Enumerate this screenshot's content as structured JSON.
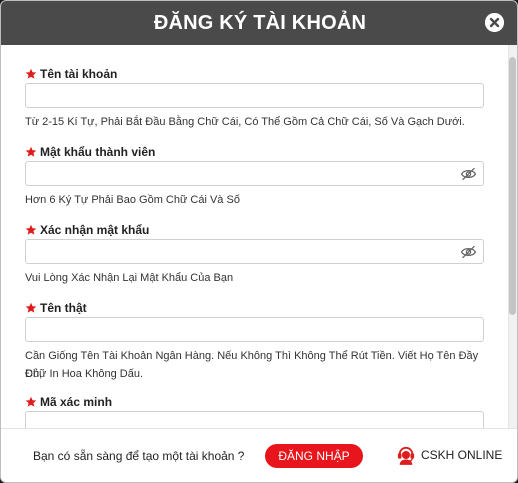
{
  "header": {
    "title": "ĐĂNG KÝ TÀI KHOẢN"
  },
  "fields": [
    {
      "label": "Tên tài khoản",
      "value": "",
      "hint": "Từ 2-15 Kí Tự, Phải Bắt Đầu Bằng Chữ Cái, Có Thể Gồm Cả Chữ Cái, Số Và Gạch Dưới."
    },
    {
      "label": "Mật khẩu thành viên",
      "value": "",
      "hint": "Hơn 6 Ký Tự Phải Bao Gồm Chữ Cái Và Số"
    },
    {
      "label": "Xác nhận mật khẩu",
      "value": "",
      "hint": "Vui Lòng Xác Nhận Lại Mật Khẩu Của Bạn"
    },
    {
      "label": "Tên thật",
      "value": "",
      "hint_line1": "Cần Giống Tên Tài Khoản Ngân Hàng. Nếu Không Thì Không Thể Rút Tiền. Viết Họ Tên Đầy Đủ,",
      "hint_line2": "Chữ In Hoa Không Dấu."
    },
    {
      "label": "Mã xác minh",
      "value": ""
    }
  ],
  "footer": {
    "prompt": "Bạn có sẵn sàng để tạo một tài khoản ?",
    "login_label": "ĐĂNG NHẬP",
    "support_label": "CSKH ONLINE"
  },
  "colors": {
    "header": "#4a4a4a",
    "accent": "#e8161c",
    "star": "#e01b1b"
  },
  "icons": [
    "close-icon",
    "required-star-icon",
    "eye-off-icon",
    "support-agent-icon"
  ]
}
